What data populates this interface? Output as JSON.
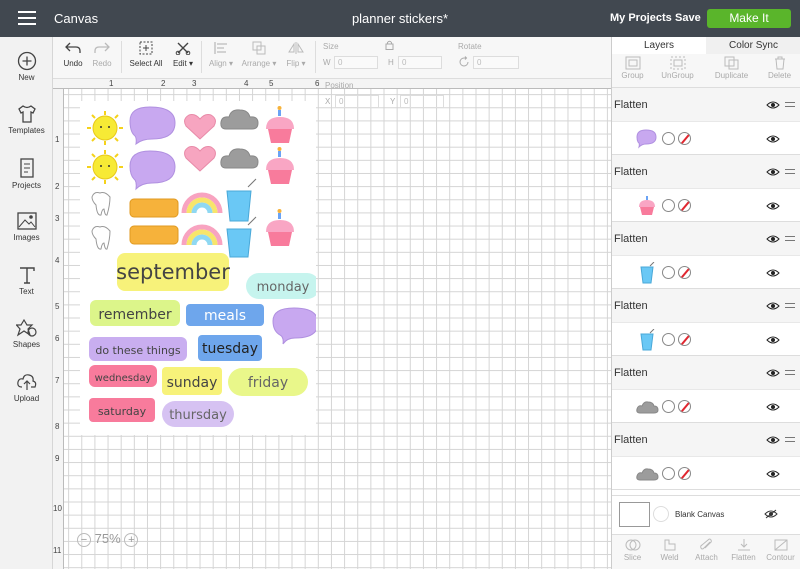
{
  "topbar": {
    "app_title": "Canvas",
    "doc_title": "planner stickers*",
    "my_projects": "My Projects",
    "save": "Save",
    "make_it": "Make It",
    "make_it_color": "#5ab52b"
  },
  "left_toolbar": {
    "items": [
      {
        "label": "New",
        "icon": "plus-circle-icon"
      },
      {
        "label": "Templates",
        "icon": "tshirt-icon"
      },
      {
        "label": "Projects",
        "icon": "projects-icon"
      },
      {
        "label": "Images",
        "icon": "image-icon"
      },
      {
        "label": "Text",
        "icon": "text-icon"
      },
      {
        "label": "Shapes",
        "icon": "shapes-icon"
      },
      {
        "label": "Upload",
        "icon": "upload-icon"
      }
    ]
  },
  "edit_toolbar": {
    "undo": "Undo",
    "redo": "Redo",
    "select_all": "Select All",
    "edit": "Edit",
    "align": "Align",
    "arrange": "Arrange",
    "flip": "Flip",
    "size": "Size",
    "w_label": "W",
    "h_label": "H",
    "w_value": "0",
    "h_value": "0",
    "rotate": "Rotate",
    "rotate_value": "0",
    "position": "Position",
    "x_label": "X",
    "y_label": "Y",
    "x_value": "0",
    "y_value": "0"
  },
  "canvas": {
    "ruler_top": [
      "1",
      "2",
      "3",
      "4",
      "5",
      "6"
    ],
    "ruler_left": [
      "1",
      "2",
      "3",
      "4",
      "5",
      "6",
      "7",
      "8",
      "9",
      "10",
      "11"
    ],
    "zoom": "75%",
    "zoom_minus": "−",
    "zoom_plus": "+",
    "stickers": {
      "september": "september",
      "monday": "monday",
      "remember": "remember",
      "meals": "meals",
      "do_these_things": "do these things",
      "tuesday": "tuesday",
      "wednesday": "wednesday",
      "sunday": "sunday",
      "friday": "friday",
      "saturday": "saturday",
      "thursday": "thursday"
    },
    "colors": {
      "yellow": "#f7f27a",
      "mint": "#c6f4ee",
      "lime": "#dcf58a",
      "blue": "#6ea6ec",
      "lavender": "#c9aef0",
      "purple_bubble": "#c8a8f0",
      "pink": "#f87b9c",
      "orange": "#f6b23b",
      "cloud": "#9c9c9c",
      "heart": "#f7a5c0",
      "sun": "#f7ea35",
      "water": "#6ac8f5"
    }
  },
  "right_panel": {
    "tabs": [
      "Layers",
      "Color Sync"
    ],
    "layer_tools": [
      "Group",
      "UnGroup",
      "Duplicate",
      "Delete"
    ],
    "groups": [
      {
        "name": "Flatten",
        "thumb": "speech-bubble"
      },
      {
        "name": "Flatten",
        "thumb": "cupcake"
      },
      {
        "name": "Flatten",
        "thumb": "drink-glass"
      },
      {
        "name": "Flatten",
        "thumb": "drink-glass"
      },
      {
        "name": "Flatten",
        "thumb": "cloud"
      },
      {
        "name": "Flatten",
        "thumb": "cloud"
      }
    ],
    "blank_canvas": "Blank Canvas",
    "bottom_tools": [
      "Slice",
      "Weld",
      "Attach",
      "Flatten",
      "Contour"
    ]
  }
}
